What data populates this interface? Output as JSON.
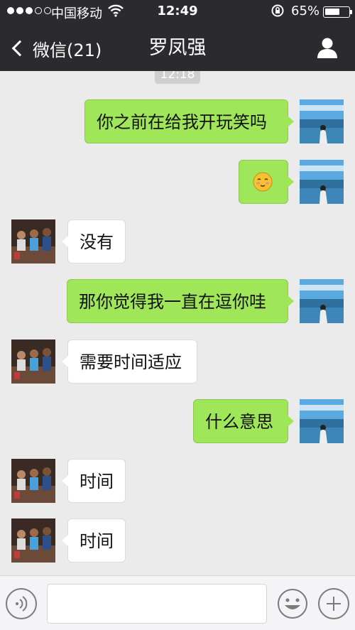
{
  "status_bar": {
    "carrier": "中国移动",
    "time": "12:49",
    "battery": "65%",
    "battery_level": 0.65
  },
  "nav": {
    "back_label": "微信(21)",
    "title": "罗凤强"
  },
  "timestamp": "12:18",
  "messages": [
    {
      "from": "me",
      "text": "你之前在给我开玩笑吗"
    },
    {
      "from": "me",
      "emoji": "smiling-face-emoji"
    },
    {
      "from": "contact",
      "text": "没有"
    },
    {
      "from": "me",
      "text": "那你觉得我一直在逗你哇"
    },
    {
      "from": "contact",
      "text": "需要时间适应"
    },
    {
      "from": "me",
      "text": "什么意思"
    },
    {
      "from": "contact",
      "text": "时间"
    },
    {
      "from": "contact",
      "text": "时间"
    }
  ],
  "input": {
    "value": "",
    "placeholder": ""
  },
  "colors": {
    "header_bg": "#2b2b2f",
    "chat_bg": "#ebebeb",
    "outgoing_bubble": "#9fe658",
    "incoming_bubble": "#ffffff"
  }
}
